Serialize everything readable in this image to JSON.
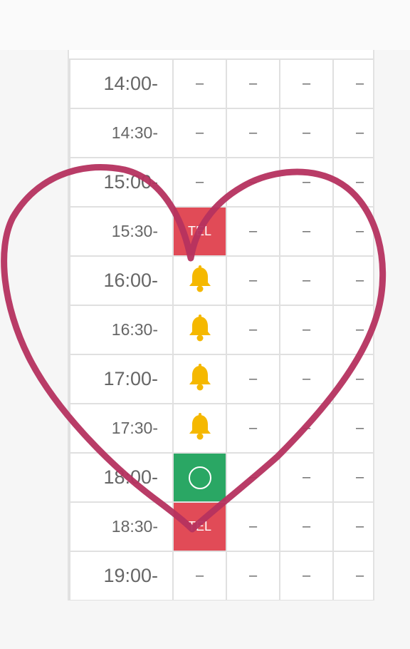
{
  "schedule": {
    "rows": [
      {
        "time": "14:00-",
        "slots": [
          "–",
          "–",
          "–",
          "–"
        ]
      },
      {
        "time": "14:30-",
        "slots": [
          "–",
          "–",
          "–",
          "–"
        ]
      },
      {
        "time": "15:00-",
        "slots": [
          "–",
          "–",
          "–",
          "–"
        ]
      },
      {
        "time": "15:30-",
        "first_slot_label": "TEL",
        "slots": [
          "TEL",
          "–",
          "–",
          "–"
        ]
      },
      {
        "time": "16:00-",
        "first_slot_icon": "bell-icon",
        "slots": [
          "",
          "–",
          "–",
          "–"
        ]
      },
      {
        "time": "16:30-",
        "first_slot_icon": "bell-icon",
        "slots": [
          "",
          "–",
          "–",
          "–"
        ]
      },
      {
        "time": "17:00-",
        "first_slot_icon": "bell-icon",
        "slots": [
          "",
          "–",
          "–",
          "–"
        ]
      },
      {
        "time": "17:30-",
        "first_slot_icon": "bell-icon",
        "slots": [
          "",
          "–",
          "–",
          "–"
        ]
      },
      {
        "time": "18:00-",
        "first_slot_icon": "circle-icon",
        "slots": [
          "",
          "–",
          "–",
          "–"
        ]
      },
      {
        "time": "18:30-",
        "first_slot_label": "TEL",
        "slots": [
          "TEL",
          "–",
          "–",
          "–"
        ]
      },
      {
        "time": "19:00-",
        "slots": [
          "–",
          "–",
          "–",
          "–"
        ]
      }
    ]
  },
  "colors": {
    "tel_cell": "#e14b57",
    "available_cell": "#2aa764",
    "bell": "#f5b800",
    "heart_stroke": "#b5325f"
  },
  "overlay": {
    "shape": "heart-drawing"
  }
}
